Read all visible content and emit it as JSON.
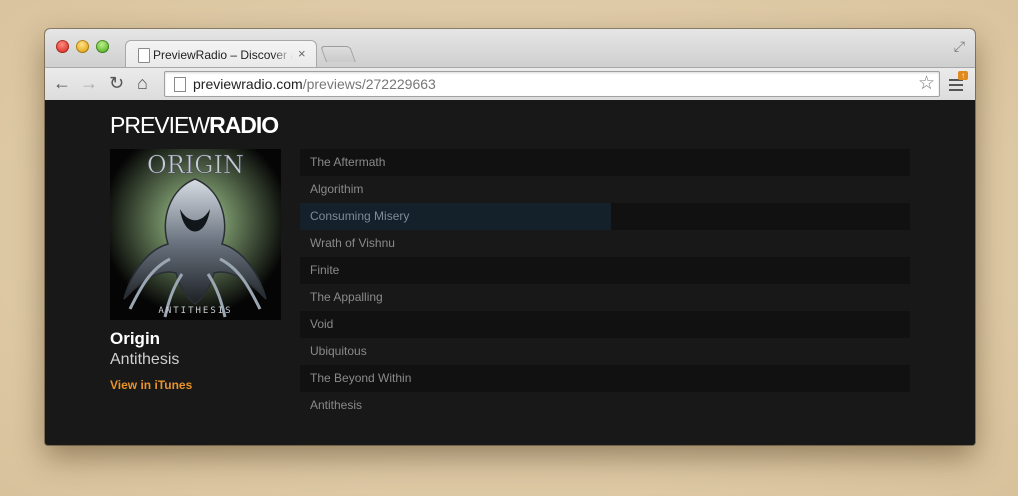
{
  "browser": {
    "tab_title": "PreviewRadio – Discover and",
    "tab_close": "×",
    "url_host": "previewradio.com",
    "url_path": "/previews/272229663",
    "icons": [
      "back-icon",
      "forward-icon",
      "reload-icon",
      "home-icon",
      "page-icon",
      "star-icon",
      "menu-icon",
      "expand-icon"
    ]
  },
  "site": {
    "logo_thin": "PREVIEW",
    "logo_bold": "RADIO"
  },
  "album": {
    "artist": "Origin",
    "title": "Antithesis",
    "itunes_link": "View in iTunes",
    "cover_text_top": "ORIGIN",
    "cover_text_bottom": "ANTITHESIS"
  },
  "tracks": [
    {
      "title": "The Aftermath"
    },
    {
      "title": "Algorithim"
    },
    {
      "title": "Consuming Misery",
      "playing": true,
      "progress": 0.51
    },
    {
      "title": "Wrath of Vishnu"
    },
    {
      "title": "Finite"
    },
    {
      "title": "The Appalling"
    },
    {
      "title": "Void"
    },
    {
      "title": "Ubiquitous"
    },
    {
      "title": "The Beyond Within"
    },
    {
      "title": "Antithesis"
    }
  ],
  "colors": {
    "accent": "#e8922a",
    "background": "#181818",
    "progress": "#14202a"
  }
}
